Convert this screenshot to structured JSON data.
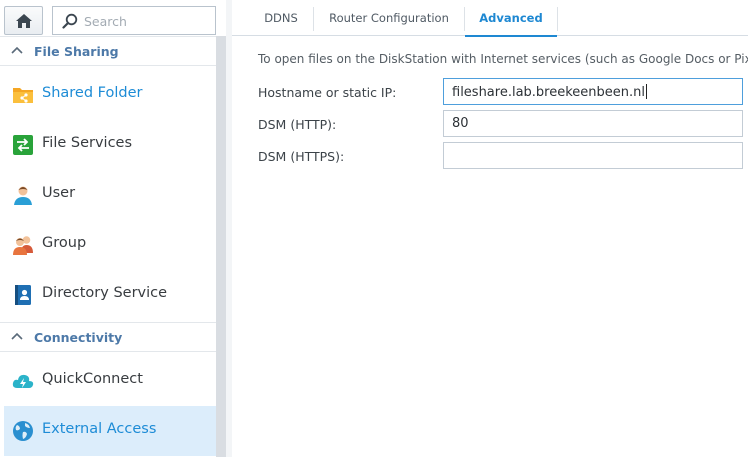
{
  "sidebar": {
    "search": {
      "placeholder": "Search"
    },
    "groups": [
      {
        "label": "File Sharing"
      },
      {
        "label": "Connectivity"
      }
    ],
    "items": [
      {
        "label": "Shared Folder",
        "icon": "shared-folder-icon"
      },
      {
        "label": "File Services",
        "icon": "file-services-icon"
      },
      {
        "label": "User",
        "icon": "user-icon"
      },
      {
        "label": "Group",
        "icon": "group-icon"
      },
      {
        "label": "Directory Service",
        "icon": "directory-service-icon"
      },
      {
        "label": "QuickConnect",
        "icon": "quickconnect-icon"
      },
      {
        "label": "External Access",
        "icon": "external-access-icon"
      }
    ]
  },
  "tabs": [
    {
      "label": "DDNS"
    },
    {
      "label": "Router Configuration"
    },
    {
      "label": "Advanced"
    }
  ],
  "content": {
    "description": "To open files on the DiskStation with Internet services (such as Google Docs or Pix",
    "hostname": {
      "label": "Hostname or static IP:",
      "value": "fileshare.lab.breekeenbeen.nl"
    },
    "http": {
      "label": "DSM (HTTP):",
      "value": "80"
    },
    "https": {
      "label": "DSM (HTTPS):",
      "value": ""
    }
  },
  "colors": {
    "accent": "#1e88d2",
    "active_bg": "#dcedfb",
    "group_header": "#4d79a8"
  }
}
